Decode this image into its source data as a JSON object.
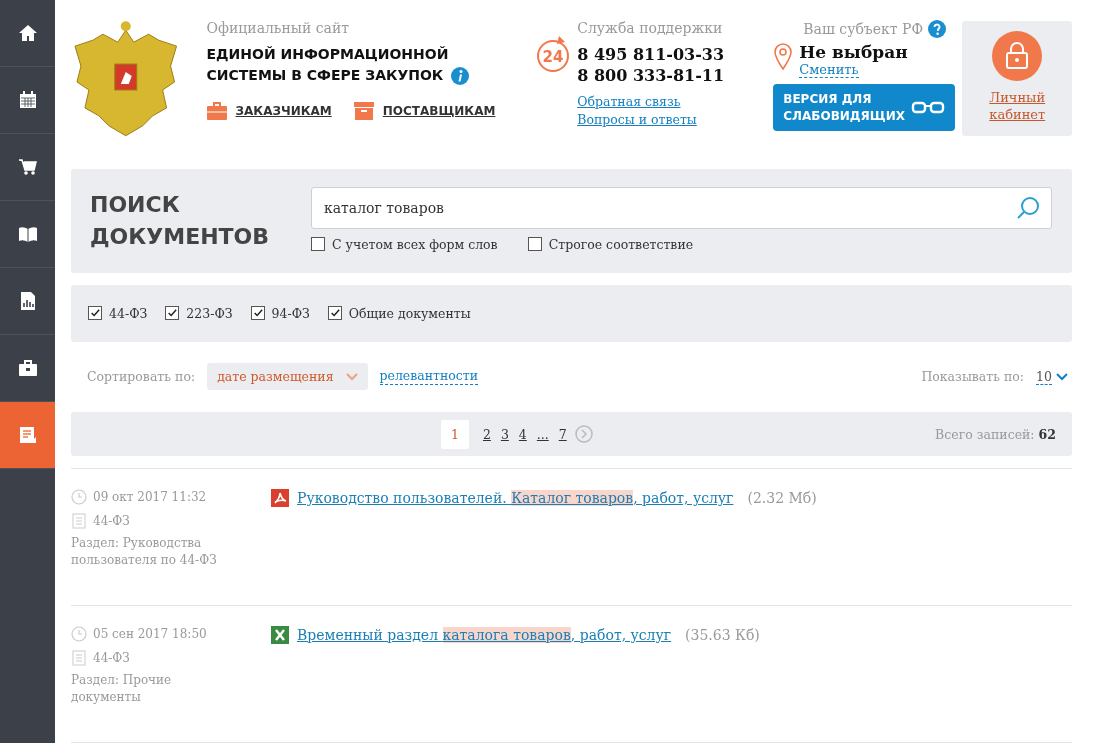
{
  "sidebar": {
    "items": [
      {
        "kind": "home",
        "selected": false
      },
      {
        "kind": "calendar",
        "selected": false
      },
      {
        "kind": "cart",
        "selected": false
      },
      {
        "kind": "book",
        "selected": false
      },
      {
        "kind": "chart",
        "selected": false
      },
      {
        "kind": "briefcase",
        "selected": false
      },
      {
        "kind": "document",
        "selected": true
      }
    ]
  },
  "header": {
    "site_caption": "Официальный сайт",
    "site_title_line1": "ЕДИНОЙ ИНФОРМАЦИОННОЙ",
    "site_title_line2": "СИСТЕМЫ В СФЕРЕ ЗАКУПОК",
    "nav_links": [
      {
        "label": "ЗАКАЗЧИКАМ",
        "kind": "briefcase"
      },
      {
        "label": "ПОСТАВЩИКАМ",
        "kind": "box"
      }
    ],
    "support": {
      "caption": "Служба поддержки",
      "badge": "24",
      "phones": [
        "8 495 811-03-33",
        "8 800 333-81-11"
      ],
      "links": [
        "Обратная связь",
        "Вопросы и ответы"
      ]
    },
    "region": {
      "caption": "Ваш субъект РФ",
      "value": "Не выбран",
      "change_link": "Сменить"
    },
    "accessibility_button": {
      "line1": "ВЕРСИЯ ДЛЯ",
      "line2": "СЛАБОВИДЯЩИХ"
    },
    "cabinet": {
      "line1": "Личный",
      "line2": "кабинет"
    }
  },
  "search": {
    "title_line1": "ПОИСК",
    "title_line2": "ДОКУМЕНТОВ",
    "query": "каталог товаров",
    "options": [
      {
        "label": "С учетом всех форм слов",
        "checked": false
      },
      {
        "label": "Строгое соответствие",
        "checked": false
      }
    ]
  },
  "filters": [
    {
      "label": "44-ФЗ",
      "checked": true
    },
    {
      "label": "223-ФЗ",
      "checked": true
    },
    {
      "label": "94-ФЗ",
      "checked": true
    },
    {
      "label": "Общие документы",
      "checked": true
    }
  ],
  "sort": {
    "label": "Сортировать по:",
    "options": [
      {
        "label": "дате размещения",
        "selected": true
      },
      {
        "label": "релевантности",
        "selected": false
      }
    ],
    "page_size_label": "Показывать по:",
    "page_size": "10"
  },
  "pagination": {
    "pages": [
      {
        "label": "1",
        "selected": true
      },
      {
        "label": "2",
        "selected": false
      },
      {
        "label": "3",
        "selected": false
      },
      {
        "label": "4",
        "selected": false
      },
      {
        "label": "...",
        "selected": false
      },
      {
        "label": "7",
        "selected": false
      }
    ],
    "total_label": "Всего записей:",
    "total": "62"
  },
  "results": [
    {
      "date": "09 окт 2017 11:32",
      "law": "44-ФЗ",
      "section": "Раздел: Руководства пользователя по 44-ФЗ",
      "kind": "pdf",
      "title_parts": [
        {
          "text": "Руководство пользователей. ",
          "highlighted": false
        },
        {
          "text": "Каталог товаров",
          "highlighted": true
        },
        {
          "text": ", работ, услуг",
          "highlighted": false
        }
      ],
      "size": "(2.32 Мб)"
    },
    {
      "date": "05 сен 2017 18:50",
      "law": "44-ФЗ",
      "section": "Раздел: Прочие документы",
      "kind": "xls",
      "title_parts": [
        {
          "text": "Временный раздел ",
          "highlighted": false
        },
        {
          "text": "каталога товаров",
          "highlighted": true
        },
        {
          "text": ", работ, услуг",
          "highlighted": false
        }
      ],
      "size": "(35.63 Кб)"
    }
  ]
}
